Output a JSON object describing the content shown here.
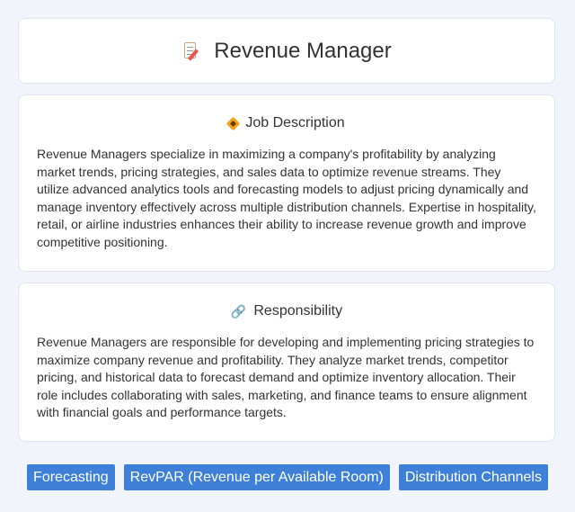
{
  "header": {
    "title": "Revenue Manager",
    "icon": "memo-pencil-icon"
  },
  "job_description": {
    "icon": "diamond-icon",
    "title": "Job Description",
    "text": "Revenue Managers specialize in maximizing a company's profitability by analyzing market trends, pricing strategies, and sales data to optimize revenue streams. They utilize advanced analytics tools and forecasting models to adjust pricing dynamically and manage inventory effectively across multiple distribution channels. Expertise in hospitality, retail, or airline industries enhances their ability to increase revenue growth and improve competitive positioning."
  },
  "responsibility": {
    "icon": "link-icon",
    "title": "Responsibility",
    "text": "Revenue Managers are responsible for developing and implementing pricing strategies to maximize company revenue and profitability. They analyze market trends, competitor pricing, and historical data to forecast demand and optimize inventory allocation. Their role includes collaborating with sales, marketing, and finance teams to ensure alignment with financial goals and performance targets."
  },
  "tags": [
    "Forecasting",
    "RevPAR (Revenue per Available Room)",
    "Distribution Channels"
  ],
  "colors": {
    "tag_bg": "#3e7fd8",
    "page_bg": "#f1f4fb"
  }
}
